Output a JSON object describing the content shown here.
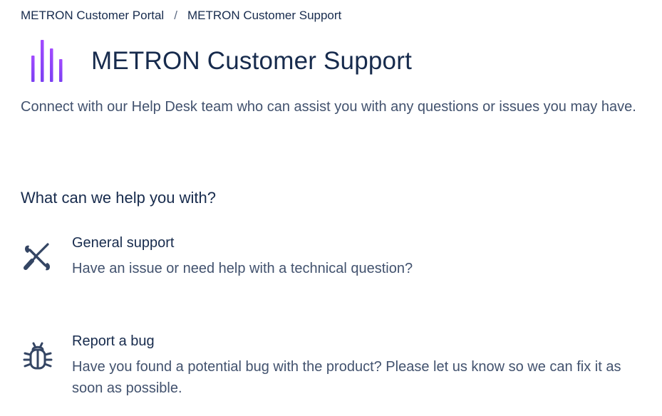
{
  "breadcrumb": {
    "portal": "METRON Customer Portal",
    "separator": "/",
    "current": "METRON Customer Support"
  },
  "header": {
    "logo_icon": "bar-chart-logo-icon",
    "logo_colors": [
      "#9f45ff",
      "#7b3ff2"
    ],
    "title": "METRON Customer Support",
    "description": "Connect with our Help Desk team who can assist you with any questions or issues you may have."
  },
  "section": {
    "heading": "What can we help you with?"
  },
  "request_types": [
    {
      "icon": "tools-icon",
      "title": "General support",
      "description": "Have an issue or need help with a technical question?"
    },
    {
      "icon": "bug-icon",
      "title": "Report a bug",
      "description": "Have you found a potential bug with the product? Please let us know so we can fix it as soon as possible."
    }
  ],
  "colors": {
    "text_primary": "#172b4d",
    "text_secondary": "#42526e",
    "icon": "#344563"
  }
}
